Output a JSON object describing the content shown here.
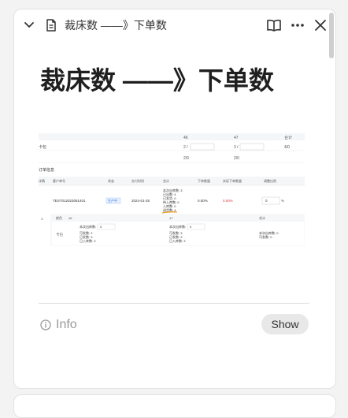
{
  "header": {
    "title": "裁床数 ——》下单数",
    "icons": {
      "collapse": "chevron-down-icon",
      "doc": "document-icon",
      "book": "book-open-icon",
      "more": "more-horizontal-icon",
      "close": "close-icon"
    }
  },
  "page": {
    "heading": "裁床数 ——》下单数"
  },
  "screenshot": {
    "row1": {
      "c1": "46",
      "c2": "47",
      "c3": "合计"
    },
    "row2": {
      "label": "卡包",
      "v1a": "2 /",
      "v2a": "3 /",
      "v3": "4/0"
    },
    "row3": {
      "v1": "2/0",
      "v2": "2/0"
    },
    "section": "订单信息",
    "table_headers": [
      "客户单号",
      "状态",
      "交付时间",
      "合计",
      "下单数量",
      "实际下单数量",
      "调整比例"
    ],
    "row_left": "详情",
    "order_no": "TEST012023081401",
    "status": "生产中",
    "date": "2024-01-25",
    "sum_lines": [
      "本次出库数: 3",
      "已出数: 4",
      "已发货: 0",
      "待入库数: 0",
      "入库数: 0",
      "退货数: 4"
    ],
    "pct1": "0.00%",
    "pct2": "0.00%",
    "ratio_value": "0",
    "ratio_unit": "%",
    "index": "1",
    "sub_headers": [
      "颜色",
      "46",
      "47",
      "合计"
    ],
    "sub_label": "卡包",
    "sub_inputs": [
      "本次出库数:",
      "本次出库数:"
    ],
    "sub_input_vals": [
      "0",
      "0"
    ],
    "sub_lines_a": [
      "可发数: 2",
      "已发数: 3",
      "已入库数: 3"
    ],
    "sub_lines_b": [
      "可发数: 3",
      "已发数: 3",
      "已入库数: 3"
    ],
    "sub_lines_c": [
      "本次出库数: 0",
      "可发数: 0"
    ]
  },
  "footer": {
    "info_label": "Info",
    "show_label": "Show"
  }
}
